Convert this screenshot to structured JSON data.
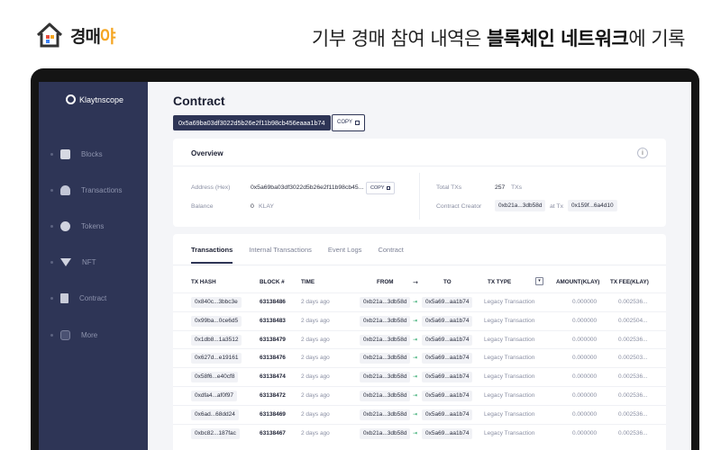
{
  "banner": {
    "brand_gyeong": "경매",
    "brand_ya": "야",
    "headline_pre": "기부 경매 참여 내역은 ",
    "headline_bold": "블록체인 네트워크",
    "headline_post": "에 기록"
  },
  "sidebar": {
    "logo": "Klaytnscope",
    "items": [
      {
        "label": "Blocks",
        "icon": "cube-icon"
      },
      {
        "label": "Transactions",
        "icon": "transactions-icon"
      },
      {
        "label": "Tokens",
        "icon": "tokens-icon"
      },
      {
        "label": "NFT",
        "icon": "diamond-icon"
      },
      {
        "label": "Contract",
        "icon": "document-icon"
      },
      {
        "label": "More",
        "icon": "more-icon"
      }
    ]
  },
  "header": {
    "title": "Contract",
    "address": "0x5a69ba03df3022d5b26e2f11b98cb456eaaa1b74",
    "copy_label": "COPY"
  },
  "overview": {
    "title": "Overview",
    "info_label": "i",
    "address_label": "Address (Hex)",
    "address_value": "0x5a69ba03df3022d5b26e2f11b98cb45...",
    "address_copy": "COPY",
    "balance_label": "Balance",
    "balance_value": "0",
    "balance_unit": "KLAY",
    "total_txs_label": "Total TXs",
    "total_txs_value": "257",
    "total_txs_unit": "TXs",
    "creator_label": "Contract Creator",
    "creator_value": "0xb21a...3db58d",
    "at_tx_label": "at Tx",
    "at_tx_value": "0x159f...6a4d10"
  },
  "tabs": [
    "Transactions",
    "Internal Transactions",
    "Event Logs",
    "Contract"
  ],
  "table": {
    "headers": {
      "tx_hash": "TX HASH",
      "block": "BLOCK #",
      "time": "TIME",
      "from": "FROM",
      "to": "TO",
      "tx_type": "TX TYPE",
      "amount": "AMOUNT(KLAY)",
      "fee": "TX FEE(KLAY)"
    },
    "rows": [
      {
        "hash": "0x840c...3bbc3e",
        "block": "63138486",
        "time": "2 days ago",
        "from": "0xb21a...3db58d",
        "to": "0x5a69...aa1b74",
        "type": "Legacy Transaction",
        "amount": "0.000000",
        "fee": "0.002536..."
      },
      {
        "hash": "0x99ba...0ce6d5",
        "block": "63138483",
        "time": "2 days ago",
        "from": "0xb21a...3db58d",
        "to": "0x5a69...aa1b74",
        "type": "Legacy Transaction",
        "amount": "0.000000",
        "fee": "0.002504..."
      },
      {
        "hash": "0x1db8...1a3512",
        "block": "63138479",
        "time": "2 days ago",
        "from": "0xb21a...3db58d",
        "to": "0x5a69...aa1b74",
        "type": "Legacy Transaction",
        "amount": "0.000000",
        "fee": "0.002536..."
      },
      {
        "hash": "0x627d...e19161",
        "block": "63138476",
        "time": "2 days ago",
        "from": "0xb21a...3db58d",
        "to": "0x5a69...aa1b74",
        "type": "Legacy Transaction",
        "amount": "0.000000",
        "fee": "0.002503..."
      },
      {
        "hash": "0x58f6...e40cf8",
        "block": "63138474",
        "time": "2 days ago",
        "from": "0xb21a...3db58d",
        "to": "0x5a69...aa1b74",
        "type": "Legacy Transaction",
        "amount": "0.000000",
        "fee": "0.002536..."
      },
      {
        "hash": "0xdfa4...af0f97",
        "block": "63138472",
        "time": "2 days ago",
        "from": "0xb21a...3db58d",
        "to": "0x5a69...aa1b74",
        "type": "Legacy Transaction",
        "amount": "0.000000",
        "fee": "0.002536..."
      },
      {
        "hash": "0x6ad...68dd24",
        "block": "63138469",
        "time": "2 days ago",
        "from": "0xb21a...3db58d",
        "to": "0x5a69...aa1b74",
        "type": "Legacy Transaction",
        "amount": "0.000000",
        "fee": "0.002536..."
      },
      {
        "hash": "0xbc82...187fac",
        "block": "63138467",
        "time": "2 days ago",
        "from": "0xb21a...3db58d",
        "to": "0x5a69...aa1b74",
        "type": "Legacy Transaction",
        "amount": "0.000000",
        "fee": "0.002536..."
      }
    ]
  },
  "colors": {
    "sidebar_bg": "#2e3556",
    "accent": "#2e3556",
    "direction_arrow": "#2ea86b",
    "brand_orange": "#f5a623"
  }
}
